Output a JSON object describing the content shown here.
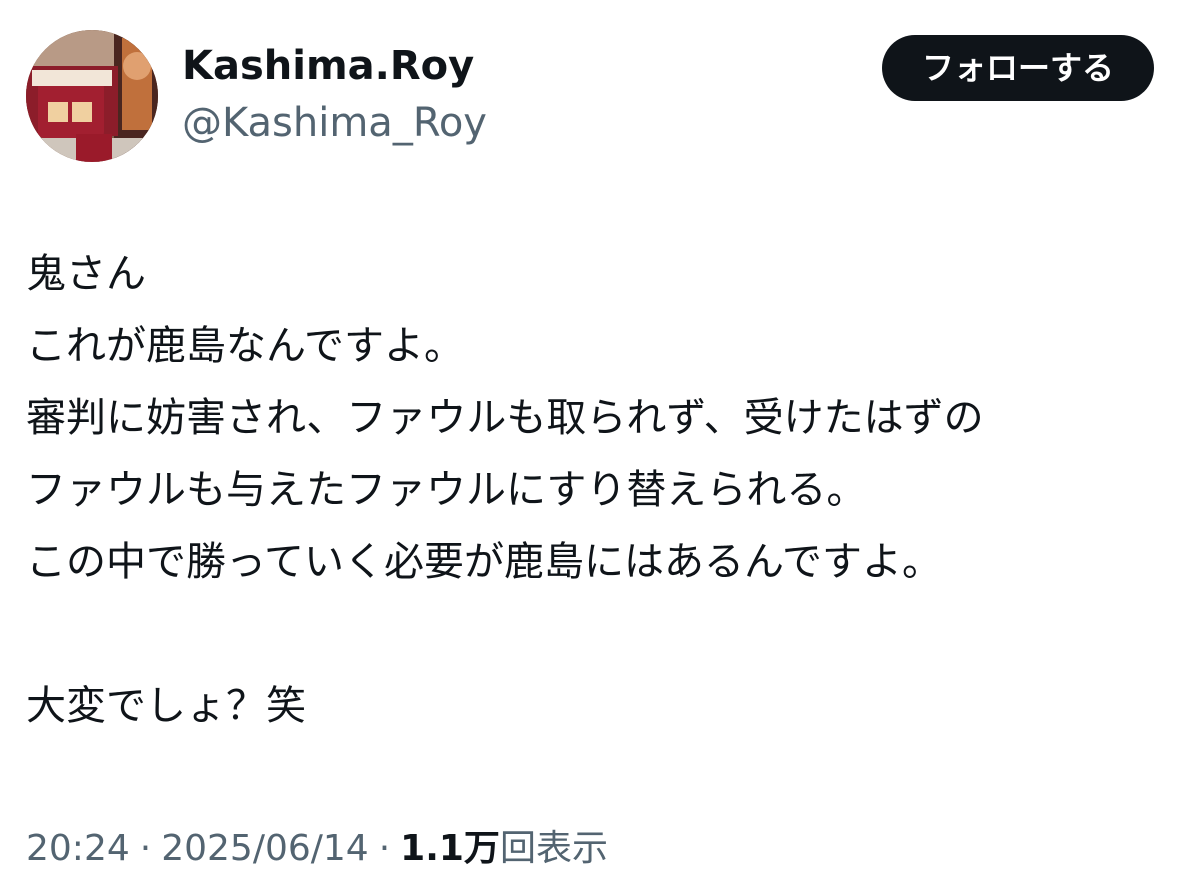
{
  "user": {
    "display_name": "Kashima.Roy",
    "handle": "@Kashima_Roy",
    "avatar": "profile-photo-icon"
  },
  "follow_button": {
    "label": "フォローする"
  },
  "tweet": {
    "lines": [
      "鬼さん",
      "これが鹿島なんですよ。",
      "審判に妨害され、ファウルも取られず、受けたはずの",
      "ファウルも与えたファウルにすり替えられる。",
      "この中で勝っていく必要が鹿島にはあるんですよ。",
      "",
      "大変でしょ？笑"
    ]
  },
  "meta": {
    "time": "20:24",
    "separator": "·",
    "date": "2025/06/14",
    "views_count": "1.1万",
    "views_label": "回表示"
  },
  "colors": {
    "text_primary": "#0f1419",
    "text_secondary": "#536471",
    "button_bg": "#0f1419",
    "button_text": "#ffffff"
  }
}
